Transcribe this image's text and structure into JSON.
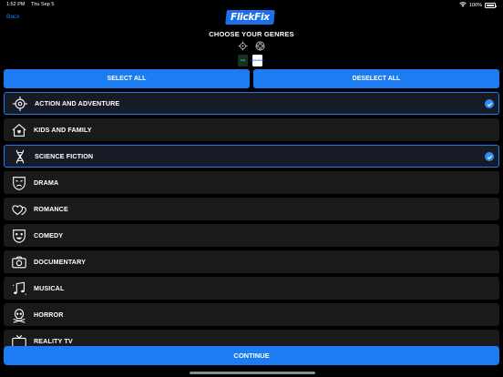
{
  "status_bar": {
    "time": "1:52 PM",
    "date": "Thu Sep 5",
    "battery": "100%"
  },
  "nav": {
    "back_label": "Back"
  },
  "brand": {
    "logo_text": "FlickFix",
    "color": "#1d6fe8"
  },
  "page": {
    "title": "CHOOSE YOUR GENRES"
  },
  "header_icons": [
    "target-icon",
    "film-reel-icon"
  ],
  "providers": [
    {
      "name": "hulu",
      "color": "#1ce783"
    },
    {
      "name": "paramount+",
      "color": "#0064ff"
    }
  ],
  "actions": {
    "select_all": "SELECT ALL",
    "deselect_all": "DESELECT ALL",
    "continue": "CONTINUE"
  },
  "colors": {
    "accent": "#1d7cf2",
    "row_bg": "#1a1a1a",
    "row_selected_bg": "#161b26",
    "background": "#000000"
  },
  "genres": [
    {
      "label": "ACTION AND ADVENTURE",
      "icon": "target-icon",
      "selected": true
    },
    {
      "label": "KIDS AND FAMILY",
      "icon": "family-house-icon",
      "selected": false
    },
    {
      "label": "SCIENCE FICTION",
      "icon": "dna-icon",
      "selected": true
    },
    {
      "label": "DRAMA",
      "icon": "drama-mask-icon",
      "selected": false
    },
    {
      "label": "ROMANCE",
      "icon": "hearts-icon",
      "selected": false
    },
    {
      "label": "COMEDY",
      "icon": "comedy-mask-icon",
      "selected": false
    },
    {
      "label": "DOCUMENTARY",
      "icon": "camera-icon",
      "selected": false
    },
    {
      "label": "MUSICAL",
      "icon": "music-notes-icon",
      "selected": false
    },
    {
      "label": "HORROR",
      "icon": "skull-icon",
      "selected": false
    },
    {
      "label": "REALITY TV",
      "icon": "tv-icon",
      "selected": false
    }
  ]
}
